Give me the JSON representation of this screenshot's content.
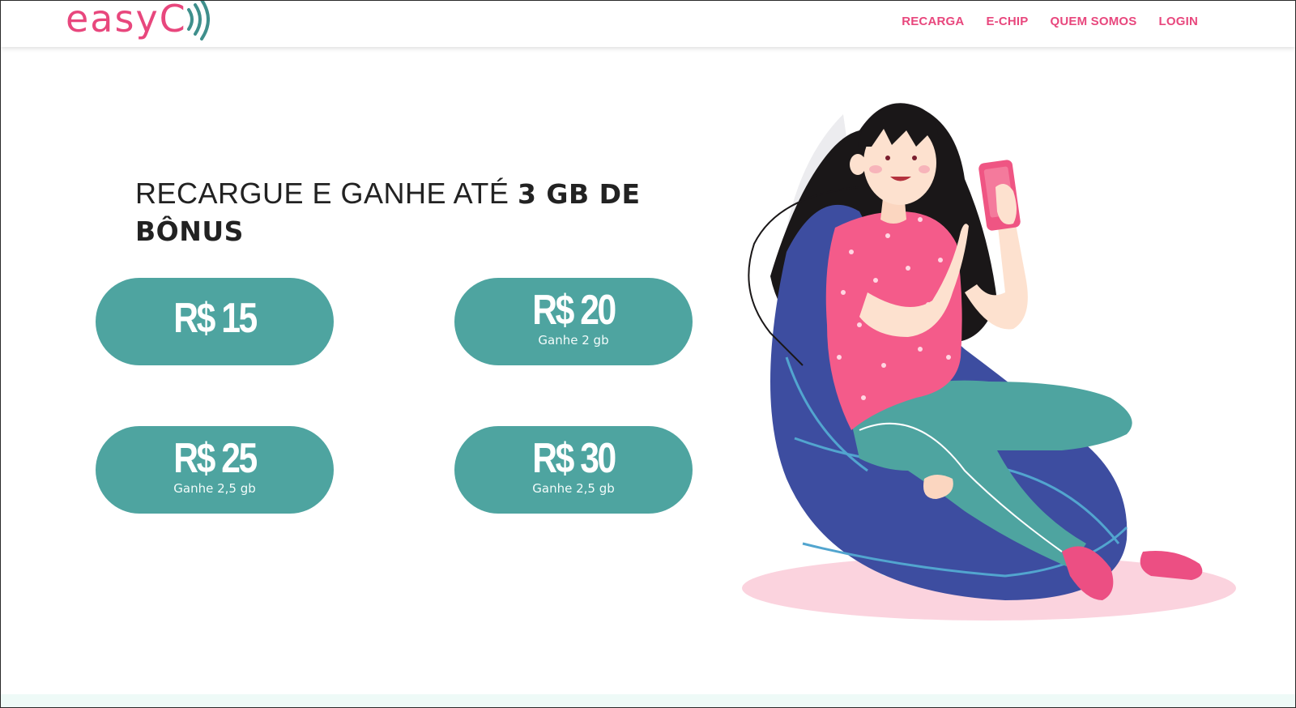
{
  "header": {
    "logo_text": "easyC",
    "nav": [
      {
        "label": "RECARGA"
      },
      {
        "label": "E-CHIP"
      },
      {
        "label": "QUEM SOMOS"
      },
      {
        "label": "LOGIN"
      }
    ]
  },
  "hero": {
    "headline_light": "RECARGUE E GANHE ATÉ ",
    "headline_bold": "3 GB DE BÔNUS"
  },
  "offers": [
    {
      "amount": "R$ 15",
      "bonus": ""
    },
    {
      "amount": "R$ 20",
      "bonus": "Ganhe 2 gb"
    },
    {
      "amount": "R$ 25",
      "bonus": "Ganhe 2,5 gb"
    },
    {
      "amount": "R$ 30",
      "bonus": "Ganhe 2,5 gb"
    }
  ],
  "colors": {
    "brand_pink": "#e8477d",
    "offer_teal": "#4ea4a0",
    "wave_teal": "#3f8f8c"
  }
}
